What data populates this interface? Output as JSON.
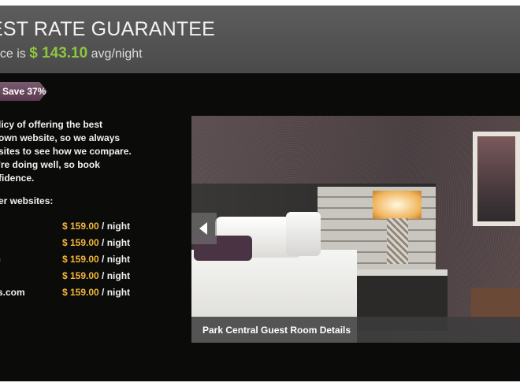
{
  "header": {
    "title": "EST RATE GUARANTEE",
    "price_prefix": "rice is",
    "price_amount": "$ 143.10",
    "price_suffix": "avg/night"
  },
  "badge": {
    "label": "Save 37%"
  },
  "policy": {
    "lines": [
      "licy of offering the best",
      "own website, so we always",
      "sites to see how we compare.",
      "'re doing well, so book",
      "fidence."
    ]
  },
  "other_label": "er websites:",
  "rates": [
    {
      "site": "",
      "price": "$ 159.00",
      "unit": " / night",
      "site_color": "normal"
    },
    {
      "site": "",
      "price": "$ 159.00",
      "unit": " / night",
      "site_color": "normal"
    },
    {
      "site": ")",
      "price": "$ 159.00",
      "unit": " / night",
      "site_color": "red"
    },
    {
      "site": "",
      "price": "$ 159.00",
      "unit": " / night",
      "site_color": "normal"
    },
    {
      "site": "s.com",
      "price": "$ 159.00",
      "unit": " / night",
      "site_color": "normal"
    }
  ],
  "photo": {
    "caption": "Park Central Guest Room Details"
  },
  "colors": {
    "accent_green": "#8dc63f",
    "price_yellow": "#f4b63a",
    "badge": "#6a4a5e",
    "panel_bg": "#0b0c09"
  },
  "icons": {
    "prev": "chevron-left-icon"
  }
}
